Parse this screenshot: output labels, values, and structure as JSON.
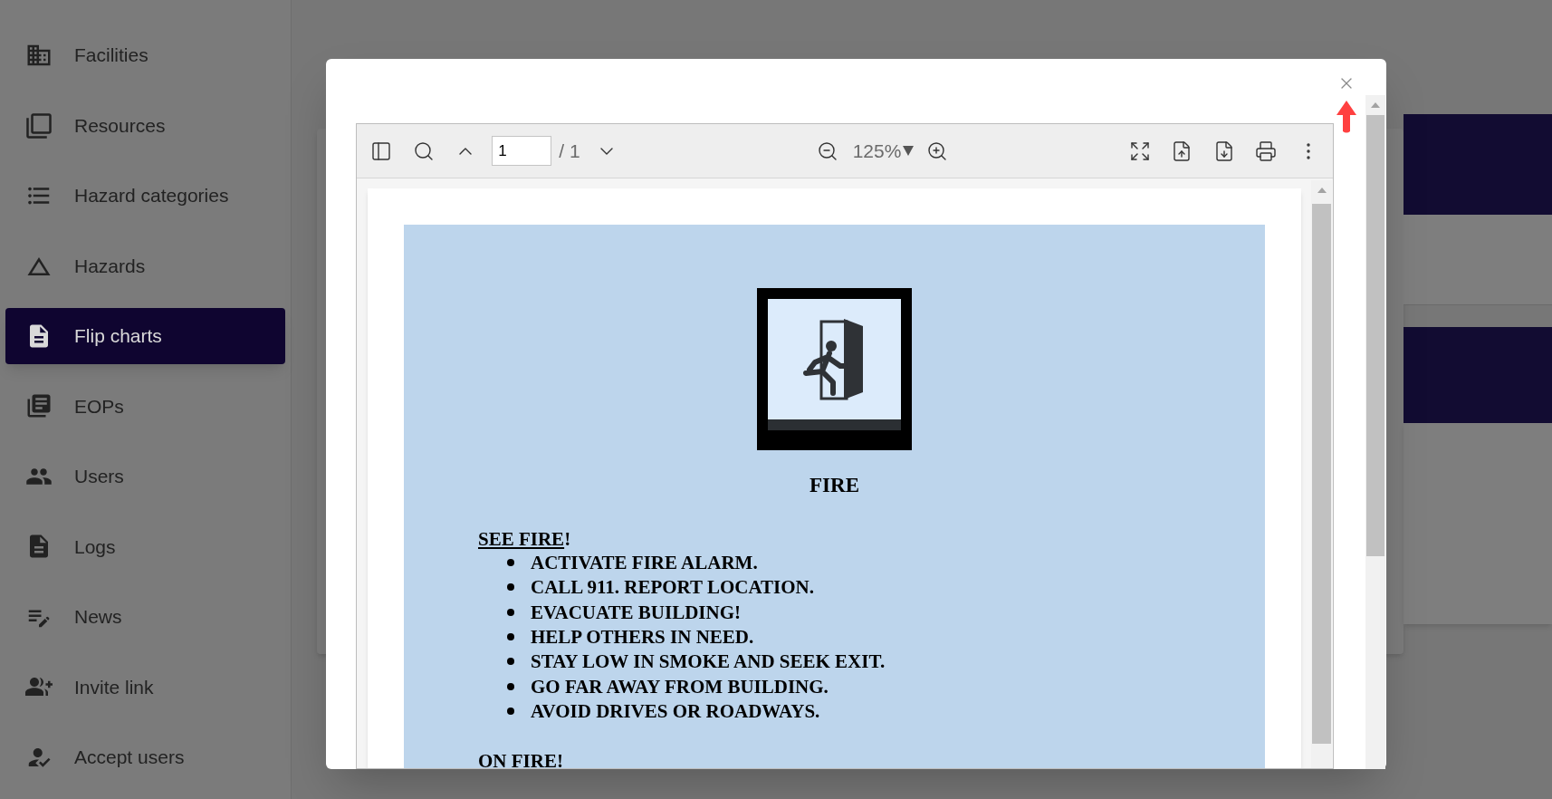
{
  "sidebar": {
    "items": [
      {
        "label": "Facilities",
        "selected": false
      },
      {
        "label": "Resources",
        "selected": false
      },
      {
        "label": "Hazard categories",
        "selected": false
      },
      {
        "label": "Hazards",
        "selected": false
      },
      {
        "label": "Flip charts",
        "selected": true
      },
      {
        "label": "EOPs",
        "selected": false
      },
      {
        "label": "Users",
        "selected": false
      },
      {
        "label": "Logs",
        "selected": false
      },
      {
        "label": "News",
        "selected": false
      },
      {
        "label": "Invite link",
        "selected": false
      },
      {
        "label": "Accept users",
        "selected": false
      }
    ]
  },
  "viewer": {
    "page_input": {
      "value": "1"
    },
    "page_total": "/ 1",
    "zoom": "125%",
    "document": {
      "title": "FIRE",
      "sections": [
        {
          "heading": "SEE FIRE",
          "suffix": "!",
          "items": [
            "ACTIVATE FIRE ALARM.",
            "CALL 911. REPORT LOCATION.",
            "EVACUATE BUILDING!",
            "HELP OTHERS IN NEED.",
            "STAY LOW IN SMOKE AND SEEK EXIT.",
            "GO FAR AWAY FROM BUILDING.",
            "AVOID DRIVES OR ROADWAYS."
          ]
        },
        {
          "heading": "ON FIRE",
          "suffix": "!"
        }
      ]
    }
  }
}
